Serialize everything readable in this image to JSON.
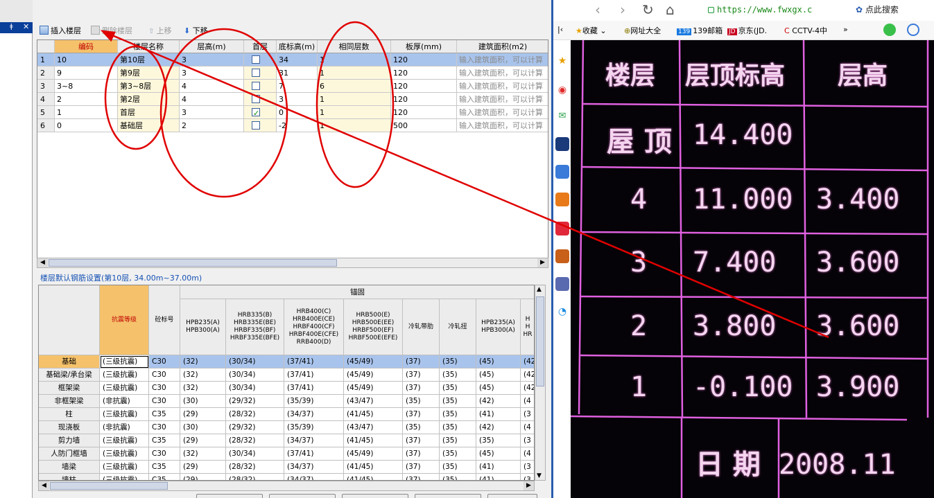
{
  "toolbar": {
    "insert_floor": "插入楼层",
    "delete_floor": "删除楼层",
    "move_up": "上移",
    "move_down": "下移"
  },
  "floor_table": {
    "columns": [
      "编码",
      "楼层名称",
      "层高(m)",
      "首层",
      "底标高(m)",
      "相同层数",
      "板厚(mm)",
      "建筑面积(m2)"
    ],
    "rows": [
      {
        "num": "1",
        "code": "10",
        "name": "第10层",
        "height": "3",
        "first": false,
        "base": "34",
        "same": "1",
        "slab": "120",
        "area": "输入建筑面积，可以计算"
      },
      {
        "num": "2",
        "code": "9",
        "name": "第9层",
        "height": "3",
        "first": false,
        "base": "31",
        "same": "1",
        "slab": "120",
        "area": "输入建筑面积，可以计算"
      },
      {
        "num": "3",
        "code": "3~8",
        "name": "第3~8层",
        "height": "4",
        "first": false,
        "base": "7",
        "same": "6",
        "slab": "120",
        "area": "输入建筑面积，可以计算"
      },
      {
        "num": "4",
        "code": "2",
        "name": "第2层",
        "height": "4",
        "first": false,
        "base": "3",
        "same": "1",
        "slab": "120",
        "area": "输入建筑面积，可以计算"
      },
      {
        "num": "5",
        "code": "1",
        "name": "首层",
        "height": "3",
        "first": true,
        "base": "0",
        "same": "1",
        "slab": "120",
        "area": "输入建筑面积，可以计算"
      },
      {
        "num": "6",
        "code": "0",
        "name": "基础层",
        "height": "2",
        "first": false,
        "base": "-2",
        "same": "1",
        "slab": "500",
        "area": "输入建筑面积，可以计算"
      }
    ]
  },
  "steel_title": "楼层默认钢筋设置(第10层, 34.00m~37.00m)",
  "steel_table": {
    "group_header": "锚固",
    "col_seismic": "抗震等级",
    "col_concrete": "砼标号",
    "col_hpb": "HPB235(A)\nHPB300(A)",
    "col_hrb335": "HRB335(B)\nHRB335E(BE)\nHRBF335(BF)\nHRBF335E(BFE)",
    "col_hrb400": "HRB400(C)\nHRB400E(CE)\nHRBF400(CF)\nHRBF400E(CFE)\nRRB400(D)",
    "col_hrb500": "HRB500(E)\nHRB500E(EE)\nHRBF500(EF)\nHRBF500E(EFE)",
    "col_cold_ribbed": "冷轧带肋",
    "col_cold_twisted": "冷轧扭",
    "col_hpb_2": "HPB235(A)\nHPB300(A)",
    "col_partial": "H\nH\nHR",
    "rows": [
      {
        "name": "基础",
        "seismic": "(三级抗震)",
        "concrete": "C30",
        "hpb": "(32)",
        "hrb335": "(30/34)",
        "hrb400": "(37/41)",
        "hrb500": "(45/49)",
        "ribbed": "(37)",
        "twisted": "(35)",
        "hpb2": "(45)",
        "extra": "(42"
      },
      {
        "name": "基础梁/承台梁",
        "seismic": "(三级抗震)",
        "concrete": "C30",
        "hpb": "(32)",
        "hrb335": "(30/34)",
        "hrb400": "(37/41)",
        "hrb500": "(45/49)",
        "ribbed": "(37)",
        "twisted": "(35)",
        "hpb2": "(45)",
        "extra": "(42"
      },
      {
        "name": "框架梁",
        "seismic": "(三级抗震)",
        "concrete": "C30",
        "hpb": "(32)",
        "hrb335": "(30/34)",
        "hrb400": "(37/41)",
        "hrb500": "(45/49)",
        "ribbed": "(37)",
        "twisted": "(35)",
        "hpb2": "(45)",
        "extra": "(42"
      },
      {
        "name": "非框架梁",
        "seismic": "(非抗震)",
        "concrete": "C30",
        "hpb": "(30)",
        "hrb335": "(29/32)",
        "hrb400": "(35/39)",
        "hrb500": "(43/47)",
        "ribbed": "(35)",
        "twisted": "(35)",
        "hpb2": "(42)",
        "extra": "(4"
      },
      {
        "name": "柱",
        "seismic": "(三级抗震)",
        "concrete": "C35",
        "hpb": "(29)",
        "hrb335": "(28/32)",
        "hrb400": "(34/37)",
        "hrb500": "(41/45)",
        "ribbed": "(37)",
        "twisted": "(35)",
        "hpb2": "(41)",
        "extra": "(3"
      },
      {
        "name": "现浇板",
        "seismic": "(非抗震)",
        "concrete": "C30",
        "hpb": "(30)",
        "hrb335": "(29/32)",
        "hrb400": "(35/39)",
        "hrb500": "(43/47)",
        "ribbed": "(35)",
        "twisted": "(35)",
        "hpb2": "(42)",
        "extra": "(4"
      },
      {
        "name": "剪力墙",
        "seismic": "(三级抗震)",
        "concrete": "C35",
        "hpb": "(29)",
        "hrb335": "(28/32)",
        "hrb400": "(34/37)",
        "hrb500": "(41/45)",
        "ribbed": "(37)",
        "twisted": "(35)",
        "hpb2": "(35)",
        "extra": "(3"
      },
      {
        "name": "人防门框墙",
        "seismic": "(三级抗震)",
        "concrete": "C30",
        "hpb": "(32)",
        "hrb335": "(30/34)",
        "hrb400": "(37/41)",
        "hrb500": "(45/49)",
        "ribbed": "(37)",
        "twisted": "(35)",
        "hpb2": "(45)",
        "extra": "(4"
      },
      {
        "name": "墙梁",
        "seismic": "(三级抗震)",
        "concrete": "C35",
        "hpb": "(29)",
        "hrb335": "(28/32)",
        "hrb400": "(34/37)",
        "hrb500": "(41/45)",
        "ribbed": "(37)",
        "twisted": "(35)",
        "hpb2": "(41)",
        "extra": "(3"
      },
      {
        "name": "墙柱",
        "seismic": "(三级抗震)",
        "concrete": "C35",
        "hpb": "(29)",
        "hrb335": "(28/32)",
        "hrb400": "(34/37)",
        "hrb500": "(41/45)",
        "ribbed": "(37)",
        "twisted": "(35)",
        "hpb2": "(41)",
        "extra": "(3"
      }
    ]
  },
  "browser": {
    "url": "https://www.fwxgx.c",
    "search_label": "点此搜索",
    "bookmarks": [
      "收藏",
      "网址大全",
      "139邮箱",
      "京东(JD.",
      "CCTV-4中"
    ],
    "bookmark_badges": [
      "139",
      "JD"
    ],
    "more": "»"
  },
  "photo_table": {
    "headers": [
      "楼层",
      "层顶标高",
      "层高"
    ],
    "rows": [
      {
        "floor": "屋 顶",
        "elev": "14.400",
        "height": ""
      },
      {
        "floor": "4",
        "elev": "11.000",
        "height": "3.400"
      },
      {
        "floor": "3",
        "elev": "7.400",
        "height": "3.600"
      },
      {
        "floor": "2",
        "elev": "3.800",
        "height": "3.600"
      },
      {
        "floor": "1",
        "elev": "-0.100",
        "height": "3.900"
      }
    ],
    "date_label": "日 期",
    "date_value": "2008.11"
  },
  "colors": {
    "annotation": "#e00000",
    "selection": "#a9c4ec",
    "header_highlight": "#f5c26b",
    "photo_line": "#e060e0"
  }
}
